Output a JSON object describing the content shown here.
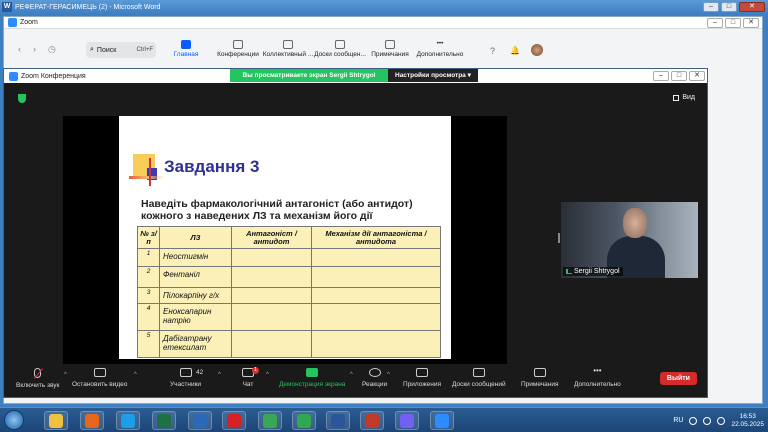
{
  "word_window": {
    "title": "РЕФЕРАТ-ГЕРАСИМЕЦЬ (2) - Microsoft Word",
    "icon": "word-icon"
  },
  "zoom_main": {
    "title": "Zoom",
    "search": {
      "label": "Поиск",
      "shortcut": "Ctrl+F"
    },
    "nav": [
      "Главная",
      "Конференции",
      "Коллективный ...",
      "Доски сообщен...",
      "Примечания",
      "Дополнительно"
    ],
    "help_glyph": "?",
    "bell_glyph": "🔔"
  },
  "conference": {
    "title": "Zoom Конференция",
    "banner_text": "Вы просматриваете экран Sergii Shtrygol",
    "view_options": "Настройки просмотра",
    "view_label": "Вид",
    "participant_name": "Sergii Shtrygol",
    "toolbar": {
      "mute": "Включить звук",
      "video": "Остановить видео",
      "participants": "Участники",
      "participants_count": "42",
      "chat": "Чат",
      "chat_badge": "1",
      "share": "Демонстрация экрана",
      "reactions": "Реакции",
      "apps": "Приложения",
      "boards": "Доски сообщений",
      "notes": "Примечания",
      "more": "Дополнительно",
      "leave": "Выйти"
    }
  },
  "slide": {
    "title": "Завдання 3",
    "question": "Наведіть фармакологічний антагоніст (або антидот) кожного з наведених ЛЗ та механізм його дії",
    "headers": [
      "№ з/п",
      "ЛЗ",
      "Антагоніст / антидот",
      "Механізм дії антагоніста / антидота"
    ],
    "rows": [
      {
        "num": "1",
        "drug": "Неостигмін"
      },
      {
        "num": "2",
        "drug": "Фентаніл"
      },
      {
        "num": "3",
        "drug": "Пілокарпіну г/х"
      },
      {
        "num": "4",
        "drug": "Еноксапарин натрію"
      },
      {
        "num": "5",
        "drug": "Дабігатрану етексилат"
      }
    ]
  },
  "taskbar": {
    "apps": [
      "explorer",
      "firefox",
      "edge",
      "excel",
      "outlook",
      "opera",
      "chrome",
      "zoom-green",
      "word",
      "app",
      "viber",
      "zoom"
    ],
    "app_colors": [
      "#f0c040",
      "#e8661c",
      "#1c9ee8",
      "#1e7145",
      "#2b6ab8",
      "#d61f26",
      "#3aa757",
      "#2fa84f",
      "#2b579a",
      "#c0392b",
      "#7360f2",
      "#2d8cff"
    ],
    "lang": "RU",
    "time": "16:53",
    "date": "22.05.2025"
  }
}
